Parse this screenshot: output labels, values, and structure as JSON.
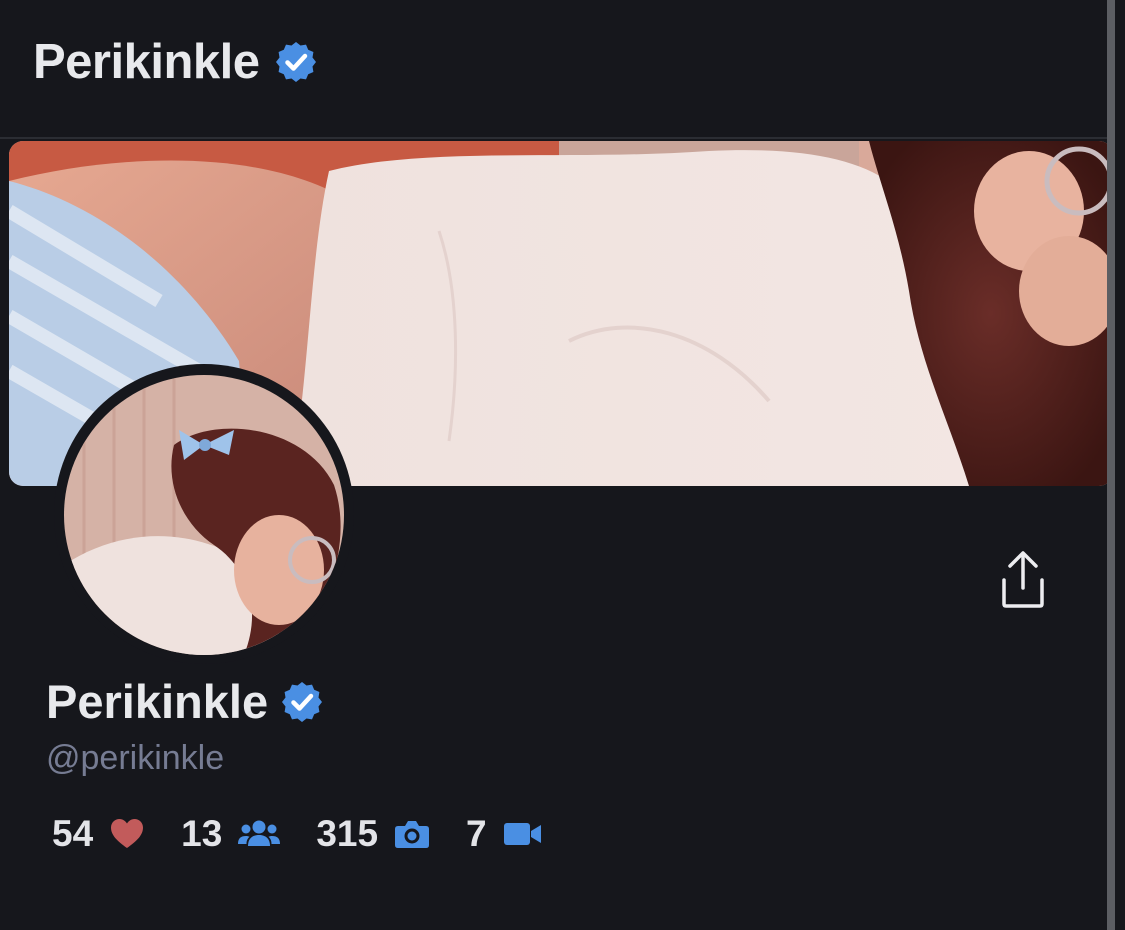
{
  "header": {
    "title": "Perikinkle"
  },
  "profile": {
    "display_name": "Perikinkle",
    "handle": "@perikinkle",
    "verified": true
  },
  "stats": [
    {
      "value": "54",
      "icon": "heart-icon",
      "color": "#c25b5b"
    },
    {
      "value": "13",
      "icon": "users-icon",
      "color": "#4a8fe3"
    },
    {
      "value": "315",
      "icon": "camera-icon",
      "color": "#4a8fe3"
    },
    {
      "value": "7",
      "icon": "video-icon",
      "color": "#4a8fe3"
    }
  ],
  "colors": {
    "background": "#16171c",
    "verified_badge": "#4a8fe3",
    "handle_text": "#767c93"
  }
}
